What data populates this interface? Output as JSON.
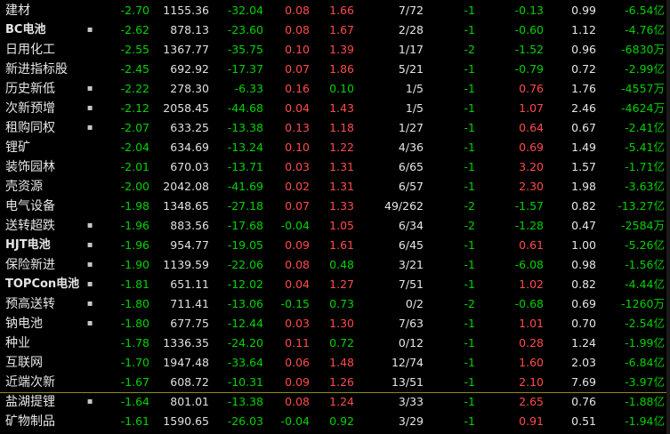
{
  "rows": [
    {
      "name": "建材",
      "mark": "",
      "c1": "-2.70",
      "c2": "1155.36",
      "c3": "-32.04",
      "c4": "0.08",
      "c5": "1.66",
      "c6": "7/72",
      "c7": "-1",
      "c8": "-0.13",
      "c9": "0.99",
      "c10": "-6.54亿",
      "s1": "neg",
      "s3": "neg",
      "s4": "pos",
      "s5": "pos",
      "s7": "neg",
      "s8": "neg",
      "s10": "neg"
    },
    {
      "name": "BC电池",
      "mark": "▪",
      "c1": "-2.62",
      "c2": "878.13",
      "c3": "-23.60",
      "c4": "0.08",
      "c5": "1.67",
      "c6": "2/28",
      "c7": "-1",
      "c8": "-0.60",
      "c9": "1.12",
      "c10": "-4.76亿",
      "s1": "neg",
      "s3": "neg",
      "s4": "pos",
      "s5": "pos",
      "s7": "neg",
      "s8": "neg",
      "s10": "neg"
    },
    {
      "name": "日用化工",
      "mark": "",
      "c1": "-2.55",
      "c2": "1367.77",
      "c3": "-35.75",
      "c4": "0.10",
      "c5": "1.39",
      "c6": "1/17",
      "c7": "-2",
      "c8": "-1.52",
      "c9": "0.96",
      "c10": "-6830万",
      "s1": "neg",
      "s3": "neg",
      "s4": "pos",
      "s5": "pos",
      "s7": "neg",
      "s8": "neg",
      "s10": "neg"
    },
    {
      "name": "新进指标股",
      "mark": "",
      "c1": "-2.45",
      "c2": "692.92",
      "c3": "-17.37",
      "c4": "0.07",
      "c5": "1.86",
      "c6": "5/21",
      "c7": "-1",
      "c8": "-0.79",
      "c9": "0.72",
      "c10": "-2.99亿",
      "s1": "neg",
      "s3": "neg",
      "s4": "pos",
      "s5": "pos",
      "s7": "neg",
      "s8": "neg",
      "s10": "neg"
    },
    {
      "name": "历史新低",
      "mark": "▪",
      "c1": "-2.22",
      "c2": "278.30",
      "c3": "-6.33",
      "c4": "0.16",
      "c5": "0.10",
      "c6": "1/5",
      "c7": "-1",
      "c8": "0.76",
      "c9": "1.76",
      "c10": "-4557万",
      "s1": "neg",
      "s3": "neg",
      "s4": "pos",
      "s5": "neg",
      "s7": "neg",
      "s8": "pos",
      "s10": "neg"
    },
    {
      "name": "次新预增",
      "mark": "▪",
      "c1": "-2.12",
      "c2": "2058.45",
      "c3": "-44.68",
      "c4": "0.04",
      "c5": "1.43",
      "c6": "1/5",
      "c7": "-1",
      "c8": "1.07",
      "c9": "2.46",
      "c10": "-4624万",
      "s1": "neg",
      "s3": "neg",
      "s4": "pos",
      "s5": "pos",
      "s7": "neg",
      "s8": "pos",
      "s10": "neg"
    },
    {
      "name": "租购同权",
      "mark": "▪",
      "c1": "-2.07",
      "c2": "633.25",
      "c3": "-13.38",
      "c4": "0.13",
      "c5": "1.18",
      "c6": "1/27",
      "c7": "-1",
      "c8": "0.64",
      "c9": "0.67",
      "c10": "-2.41亿",
      "s1": "neg",
      "s3": "neg",
      "s4": "pos",
      "s5": "pos",
      "s7": "neg",
      "s8": "pos",
      "s10": "neg"
    },
    {
      "name": "锂矿",
      "mark": "",
      "c1": "-2.04",
      "c2": "634.69",
      "c3": "-13.24",
      "c4": "0.10",
      "c5": "1.22",
      "c6": "4/36",
      "c7": "-1",
      "c8": "0.69",
      "c9": "1.49",
      "c10": "-5.41亿",
      "s1": "neg",
      "s3": "neg",
      "s4": "pos",
      "s5": "pos",
      "s7": "neg",
      "s8": "pos",
      "s10": "neg"
    },
    {
      "name": "装饰园林",
      "mark": "",
      "c1": "-2.01",
      "c2": "670.03",
      "c3": "-13.71",
      "c4": "0.03",
      "c5": "1.31",
      "c6": "6/65",
      "c7": "-1",
      "c8": "3.20",
      "c9": "1.57",
      "c10": "-1.71亿",
      "s1": "neg",
      "s3": "neg",
      "s4": "pos",
      "s5": "pos",
      "s7": "neg",
      "s8": "pos",
      "s10": "neg"
    },
    {
      "name": "壳资源",
      "mark": "",
      "c1": "-2.00",
      "c2": "2042.08",
      "c3": "-41.69",
      "c4": "0.02",
      "c5": "1.31",
      "c6": "6/57",
      "c7": "-1",
      "c8": "2.30",
      "c9": "1.98",
      "c10": "-3.63亿",
      "s1": "neg",
      "s3": "neg",
      "s4": "pos",
      "s5": "pos",
      "s7": "neg",
      "s8": "pos",
      "s10": "neg"
    },
    {
      "name": "电气设备",
      "mark": "",
      "c1": "-1.98",
      "c2": "1348.65",
      "c3": "-27.18",
      "c4": "0.07",
      "c5": "1.33",
      "c6": "49/262",
      "c7": "-2",
      "c8": "-1.57",
      "c9": "0.82",
      "c10": "-13.27亿",
      "s1": "neg",
      "s3": "neg",
      "s4": "pos",
      "s5": "pos",
      "s7": "neg",
      "s8": "neg",
      "s10": "neg"
    },
    {
      "name": "送转超跌",
      "mark": "▪",
      "c1": "-1.96",
      "c2": "883.56",
      "c3": "-17.68",
      "c4": "-0.04",
      "c5": "1.05",
      "c6": "6/34",
      "c7": "-2",
      "c8": "-1.28",
      "c9": "0.47",
      "c10": "-2584万",
      "s1": "neg",
      "s3": "neg",
      "s4": "neg",
      "s5": "pos",
      "s7": "neg",
      "s8": "neg",
      "s10": "neg"
    },
    {
      "name": "HJT电池",
      "mark": "▪",
      "c1": "-1.96",
      "c2": "954.77",
      "c3": "-19.05",
      "c4": "0.09",
      "c5": "1.61",
      "c6": "6/45",
      "c7": "-1",
      "c8": "0.61",
      "c9": "1.00",
      "c10": "-5.26亿",
      "s1": "neg",
      "s3": "neg",
      "s4": "pos",
      "s5": "pos",
      "s7": "neg",
      "s8": "pos",
      "s10": "neg"
    },
    {
      "name": "保险新进",
      "mark": "▪",
      "c1": "-1.90",
      "c2": "1139.59",
      "c3": "-22.06",
      "c4": "0.08",
      "c5": "0.48",
      "c6": "3/21",
      "c7": "-1",
      "c8": "-6.08",
      "c9": "0.98",
      "c10": "-1.56亿",
      "s1": "neg",
      "s3": "neg",
      "s4": "pos",
      "s5": "neg",
      "s7": "neg",
      "s8": "neg",
      "s10": "neg"
    },
    {
      "name": "TOPCon电池",
      "mark": "▪",
      "c1": "-1.81",
      "c2": "651.11",
      "c3": "-12.02",
      "c4": "0.04",
      "c5": "1.27",
      "c6": "7/51",
      "c7": "-1",
      "c8": "1.02",
      "c9": "0.82",
      "c10": "-4.44亿",
      "s1": "neg",
      "s3": "neg",
      "s4": "pos",
      "s5": "pos",
      "s7": "neg",
      "s8": "pos",
      "s10": "neg"
    },
    {
      "name": "预高送转",
      "mark": "▪",
      "c1": "-1.80",
      "c2": "711.41",
      "c3": "-13.06",
      "c4": "-0.15",
      "c5": "0.73",
      "c6": "0/2",
      "c7": "-2",
      "c8": "-0.68",
      "c9": "0.69",
      "c10": "-1260万",
      "s1": "neg",
      "s3": "neg",
      "s4": "neg",
      "s5": "neg",
      "s7": "neg",
      "s8": "neg",
      "s10": "neg"
    },
    {
      "name": "钠电池",
      "mark": "▪",
      "c1": "-1.80",
      "c2": "677.75",
      "c3": "-12.44",
      "c4": "0.03",
      "c5": "1.30",
      "c6": "7/63",
      "c7": "-1",
      "c8": "1.01",
      "c9": "0.70",
      "c10": "-2.54亿",
      "s1": "neg",
      "s3": "neg",
      "s4": "pos",
      "s5": "pos",
      "s7": "neg",
      "s8": "pos",
      "s10": "neg"
    },
    {
      "name": "种业",
      "mark": "",
      "c1": "-1.78",
      "c2": "1336.35",
      "c3": "-24.20",
      "c4": "0.11",
      "c5": "0.72",
      "c6": "0/12",
      "c7": "-1",
      "c8": "0.28",
      "c9": "1.24",
      "c10": "-1.99亿",
      "s1": "neg",
      "s3": "neg",
      "s4": "pos",
      "s5": "neg",
      "s7": "neg",
      "s8": "pos",
      "s10": "neg"
    },
    {
      "name": "互联网",
      "mark": "",
      "c1": "-1.70",
      "c2": "1947.48",
      "c3": "-33.64",
      "c4": "0.06",
      "c5": "1.48",
      "c6": "12/74",
      "c7": "-1",
      "c8": "1.60",
      "c9": "2.03",
      "c10": "-6.84亿",
      "s1": "neg",
      "s3": "neg",
      "s4": "pos",
      "s5": "pos",
      "s7": "neg",
      "s8": "pos",
      "s10": "neg"
    },
    {
      "name": "近端次新",
      "mark": "",
      "c1": "-1.67",
      "c2": "608.72",
      "c3": "-10.31",
      "c4": "0.09",
      "c5": "1.26",
      "c6": "13/51",
      "c7": "-1",
      "c8": "2.10",
      "c9": "7.69",
      "c10": "-3.97亿",
      "s1": "neg",
      "s3": "neg",
      "s4": "pos",
      "s5": "pos",
      "s7": "neg",
      "s8": "pos",
      "s10": "neg"
    },
    {
      "name": "盐湖提锂",
      "mark": "▪",
      "c1": "-1.64",
      "c2": "801.01",
      "c3": "-13.38",
      "c4": "0.08",
      "c5": "1.24",
      "c6": "3/33",
      "c7": "-1",
      "c8": "2.65",
      "c9": "0.76",
      "c10": "-1.88亿",
      "s1": "neg",
      "s3": "neg",
      "s4": "pos",
      "s5": "pos",
      "s7": "neg",
      "s8": "pos",
      "s10": "neg"
    },
    {
      "name": "矿物制品",
      "mark": "",
      "c1": "-1.61",
      "c2": "1590.65",
      "c3": "-26.03",
      "c4": "-0.04",
      "c5": "0.92",
      "c6": "3/29",
      "c7": "-1",
      "c8": "0.91",
      "c9": "0.51",
      "c10": "-1.94亿",
      "s1": "neg",
      "s3": "neg",
      "s4": "neg",
      "s5": "neg",
      "s7": "neg",
      "s8": "pos",
      "s10": "neg"
    }
  ],
  "colors": {
    "positive": "#ff4a4a",
    "negative": "#00d200",
    "neutral": "#e6e6e6",
    "background": "#000000",
    "divider": "#8c8c1e"
  }
}
